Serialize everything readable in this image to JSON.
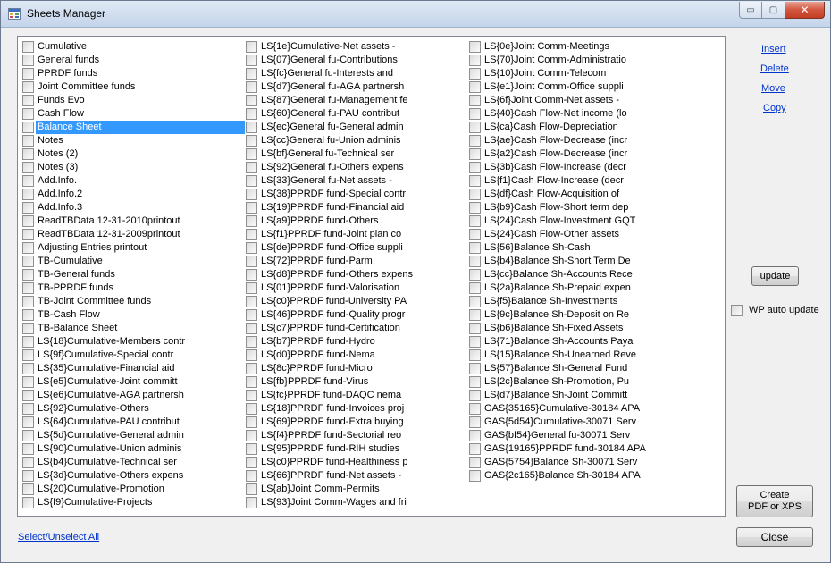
{
  "window": {
    "title": "Sheets Manager",
    "caption": {
      "minimize": "▭",
      "maximize": "▢",
      "close": "✕"
    }
  },
  "sheets": {
    "selected_label": "Balance Sheet",
    "columns": [
      [
        "Cumulative",
        "General funds",
        "PPRDF funds",
        "Joint Committee funds",
        "Funds Evo",
        "Cash Flow",
        "Balance Sheet",
        "Notes",
        "Notes (2)",
        "Notes (3)",
        "Add.Info.",
        "Add.Info.2",
        "Add.Info.3",
        "ReadTBData 12-31-2010printout",
        "ReadTBData 12-31-2009printout",
        "Adjusting Entries printout",
        "TB-Cumulative",
        "TB-General funds",
        "TB-PPRDF funds",
        "TB-Joint Committee funds",
        "TB-Cash Flow",
        "TB-Balance Sheet",
        "LS{18}Cumulative-Members contr",
        "LS{9f}Cumulative-Special contr",
        "LS{35}Cumulative-Financial aid",
        "LS{e5}Cumulative-Joint committ",
        "LS{e6}Cumulative-AGA partnersh",
        "LS{92}Cumulative-Others",
        "LS{64}Cumulative-PAU contribut",
        "LS{5d}Cumulative-General admin",
        "LS{90}Cumulative-Union adminis",
        "LS{b4}Cumulative-Technical ser",
        "LS{3d}Cumulative-Others expens",
        "LS{20}Cumulative-Promotion",
        "LS{f9}Cumulative-Projects"
      ],
      [
        "LS{1e}Cumulative-Net assets -",
        "LS{07}General fu-Contributions",
        "LS{fc}General fu-Interests and",
        "LS{d7}General fu-AGA partnersh",
        "LS{87}General fu-Management fe",
        "LS{60}General fu-PAU contribut",
        "LS{ec}General fu-General admin",
        "LS{cc}General fu-Union adminis",
        "LS{bf}General fu-Technical ser",
        "LS{92}General fu-Others expens",
        "LS{33}General fu-Net assets -",
        "LS{38}PPRDF fund-Special contr",
        "LS{19}PPRDF fund-Financial aid",
        "LS{a9}PPRDF fund-Others",
        "LS{f1}PPRDF fund-Joint plan co",
        "LS{de}PPRDF fund-Office suppli",
        "LS{72}PPRDF fund-Parm",
        "LS{d8}PPRDF fund-Others expens",
        "LS{01}PPRDF fund-Valorisation",
        "LS{c0}PPRDF fund-University PA",
        "LS{46}PPRDF fund-Quality progr",
        "LS{c7}PPRDF fund-Certification",
        "LS{b7}PPRDF fund-Hydro",
        "LS{d0}PPRDF fund-Nema",
        "LS{8c}PPRDF fund-Micro",
        "LS{fb}PPRDF fund-Virus",
        "LS{fc}PPRDF fund-DAQC nema",
        "LS{18}PPRDF fund-Invoices proj",
        "LS{69}PPRDF fund-Extra buying",
        "LS{f4}PPRDF fund-Sectorial reo",
        "LS{95}PPRDF fund-RIH studies",
        "LS{c0}PPRDF fund-Healthiness p",
        "LS{66}PPRDF fund-Net assets -",
        "LS{ab}Joint Comm-Permits",
        "LS{93}Joint Comm-Wages and fri"
      ],
      [
        "LS{0e}Joint Comm-Meetings",
        "LS{70}Joint Comm-Administratio",
        "LS{10}Joint Comm-Telecom",
        "LS{e1}Joint Comm-Office suppli",
        "LS{6f}Joint Comm-Net assets -",
        "LS{40}Cash Flow-Net income (lo",
        "LS{ca}Cash Flow-Depreciation",
        "LS{ae}Cash Flow-Decrease (incr",
        "LS{a2}Cash Flow-Decrease (incr",
        "LS{3b}Cash Flow-Increase (decr",
        "LS{f1}Cash Flow-Increase (decr",
        "LS{df}Cash Flow-Acquisition of",
        "LS{b9}Cash Flow-Short term dep",
        "LS{24}Cash Flow-Investment GQT",
        "LS{24}Cash Flow-Other assets",
        "LS{56}Balance Sh-Cash",
        "LS{b4}Balance Sh-Short Term De",
        "LS{cc}Balance Sh-Accounts Rece",
        "LS{2a}Balance Sh-Prepaid expen",
        "LS{f5}Balance Sh-Investments",
        "LS{9c}Balance Sh-Deposit on Re",
        "LS{b6}Balance Sh-Fixed Assets",
        "LS{71}Balance Sh-Accounts Paya",
        "LS{15}Balance Sh-Unearned Reve",
        "LS{57}Balance Sh-General Fund",
        "LS{2c}Balance Sh-Promotion, Pu",
        "LS{d7}Balance Sh-Joint Committ",
        "GAS{35165}Cumulative-30184 APA",
        "GAS{5d54}Cumulative-30071 Serv",
        "GAS{bf54}General fu-30071 Serv",
        "GAS{19165}PPRDF fund-30184 APA",
        "GAS{5754}Balance Sh-30071 Serv",
        "GAS{2c165}Balance Sh-30184 APA"
      ]
    ]
  },
  "actions": {
    "insert": "Insert",
    "delete": "Delete",
    "move": "Move",
    "copy": "Copy",
    "update": "update",
    "wp_auto_update": "WP auto update",
    "create_pdf_line1": "Create",
    "create_pdf_line2": "PDF or XPS",
    "close": "Close",
    "select_all": "Select/Unselect All"
  }
}
